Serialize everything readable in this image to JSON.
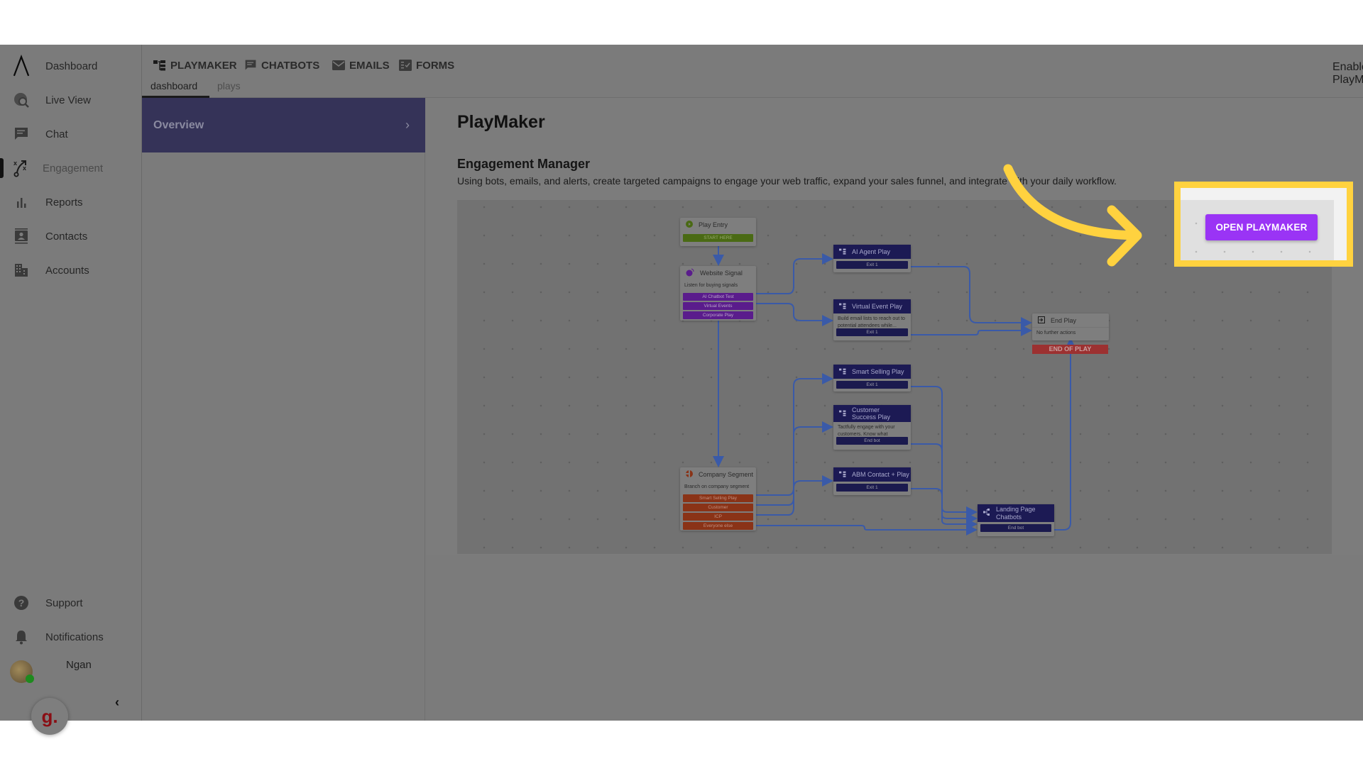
{
  "sidebar": {
    "items": [
      {
        "label": "Dashboard",
        "icon": "logo-icon"
      },
      {
        "label": "Live View",
        "icon": "live-view-icon"
      },
      {
        "label": "Chat",
        "icon": "chat-icon"
      },
      {
        "label": "Engagement",
        "icon": "engagement-icon",
        "active": true
      },
      {
        "label": "Reports",
        "icon": "bar-chart-icon"
      },
      {
        "label": "Contacts",
        "icon": "contact-card-icon"
      },
      {
        "label": "Accounts",
        "icon": "building-icon"
      }
    ],
    "bottom_items": [
      {
        "label": "Support",
        "icon": "help-icon"
      },
      {
        "label": "Notifications",
        "icon": "bell-icon"
      }
    ],
    "user_name": "Ngan",
    "badge_letter": "g.",
    "collapse_glyph": "‹"
  },
  "topnav": {
    "tabs": [
      {
        "label": "PLAYMAKER",
        "icon": "playmaker-icon",
        "active": true
      },
      {
        "label": "CHATBOTS",
        "icon": "chatbot-icon"
      },
      {
        "label": "EMAILS",
        "icon": "email-icon"
      },
      {
        "label": "FORMS",
        "icon": "forms-icon"
      }
    ],
    "subtabs": [
      {
        "label": "dashboard",
        "active": true
      },
      {
        "label": "plays"
      }
    ],
    "enable_label": "Enable PlayMaker",
    "enable_on": true
  },
  "leftpanel": {
    "overview_label": "Overview",
    "chevron": "›"
  },
  "main": {
    "title": "PlayMaker",
    "section_title": "Engagement Manager",
    "section_desc": "Using bots, emails, and alerts, create targeted campaigns to engage your web traffic, expand your sales funnel, and integrate with your daily workflow.",
    "open_button": "OPEN PLAYMAKER"
  },
  "diagram": {
    "play_entry": {
      "title": "Play Entry",
      "exit": "START HERE"
    },
    "website_signal": {
      "title": "Website Signal",
      "desc": "Listen for buying signals",
      "exits": [
        "AI Chatbot Test",
        "Virtual Events",
        "Corporate Play"
      ]
    },
    "ai_agent": {
      "title": "AI Agent Play",
      "exit": "Exit 1"
    },
    "virtual_event": {
      "title": "Virtual Event Play",
      "desc": "Build email lists to reach out to potential attendees while...",
      "exit": "Exit 1"
    },
    "end_play": {
      "title": "End Play",
      "desc": "No further actions",
      "bar": "END OF PLAY"
    },
    "smart_selling": {
      "title": "Smart Selling Play",
      "exit": "Exit 1"
    },
    "customer_success": {
      "title": "Customer Success Play",
      "desc": "Tactfully engage with your customers. Know what pages...",
      "exit": "End bot"
    },
    "abm_contact": {
      "title": "ABM Contact + Play",
      "exit": "Exit 1"
    },
    "company_segment": {
      "title": "Company Segment",
      "desc": "Branch on company segment",
      "exits": [
        "Smart Selling Play",
        "Customer",
        "ICP",
        "Everyone else"
      ]
    },
    "landing_page": {
      "title": "Landing Page Chatbots",
      "exit": "End bot"
    }
  },
  "colors": {
    "accent_purple": "#9a34f5",
    "highlight_yellow": "#ffd23f",
    "node_navy": "#1c1a54",
    "connector_blue": "#3a5aa8"
  }
}
